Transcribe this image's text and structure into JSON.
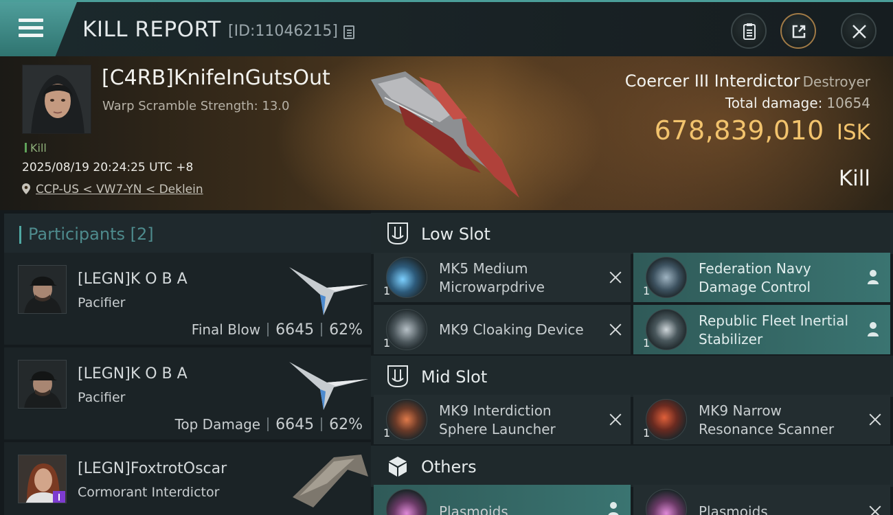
{
  "header": {
    "title": "KILL REPORT",
    "report_id": "[ID:11046215]"
  },
  "victim": {
    "name": "[C4RB]KnifeInGutsOut",
    "warp_scramble": "Warp Scramble Strength: 13.0",
    "tag": "Kill",
    "datetime": "2025/08/19 20:24:25 UTC +8",
    "location": "CCP-US < VW7-YN < Deklein",
    "ship": "Coercer III Interdictor",
    "ship_class": "Destroyer",
    "total_damage_label": "Total damage:",
    "total_damage": "10654",
    "isk_value": "678,839,010",
    "isk_unit": "ISK",
    "result": "Kill"
  },
  "participants": {
    "title": "Participants",
    "count": "[2]",
    "list": [
      {
        "name": "[LEGN]K O B A",
        "ship": "Pacifier",
        "label": "Final Blow",
        "damage": "6645",
        "percent": "62%"
      },
      {
        "name": "[LEGN]K O B A",
        "ship": "Pacifier",
        "label": "Top Damage",
        "damage": "6645",
        "percent": "62%"
      },
      {
        "name": "[LEGN]FoxtrotOscar",
        "ship": "Cormorant Interdictor"
      }
    ]
  },
  "fittings": {
    "low_slot": {
      "label": "Low Slot",
      "items": [
        {
          "name": "MK5 Medium Microwarpdrive",
          "qty": "1",
          "status": "destroyed"
        },
        {
          "name": "Federation Navy Damage Control",
          "qty": "1",
          "status": "dropped"
        },
        {
          "name": "MK9 Cloaking Device",
          "qty": "1",
          "status": "destroyed"
        },
        {
          "name": "Republic Fleet Inertial Stabilizer",
          "qty": "1",
          "status": "dropped"
        }
      ]
    },
    "mid_slot": {
      "label": "Mid Slot",
      "items": [
        {
          "name": "MK9 Interdiction Sphere Launcher",
          "qty": "1",
          "status": "destroyed"
        },
        {
          "name": "MK9 Narrow Resonance Scanner",
          "qty": "1",
          "status": "destroyed"
        }
      ]
    },
    "others": {
      "label": "Others",
      "items": [
        {
          "name": "Plasmoids",
          "status": "dropped"
        },
        {
          "name": "Plasmoids",
          "status": "destroyed"
        }
      ]
    }
  },
  "colors": {
    "accent": "#4fa8a3",
    "isk": "#f2c36d",
    "highlight_item": "#3a7471"
  }
}
